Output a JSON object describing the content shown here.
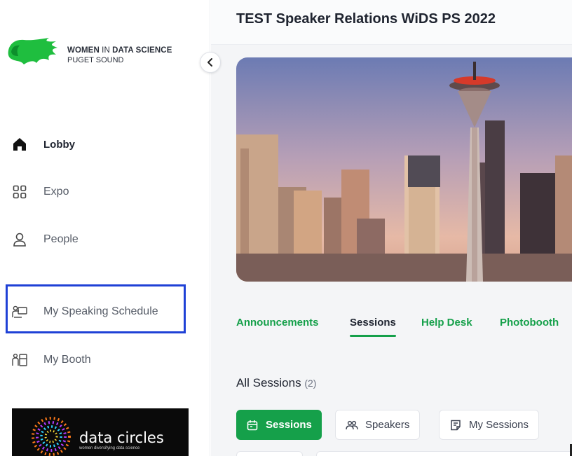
{
  "brand": {
    "name_bold1": "WOMEN",
    "name_thin": " IN ",
    "name_bold2": "DATA SCIENCE",
    "subtitle": "PUGET SOUND"
  },
  "sidebar": {
    "items": [
      {
        "label": "Lobby",
        "icon": "home-icon",
        "active": true
      },
      {
        "label": "Expo",
        "icon": "grid-icon",
        "active": false
      },
      {
        "label": "People",
        "icon": "person-icon",
        "active": false
      },
      {
        "label": "My Speaking Schedule",
        "icon": "presenter-icon",
        "active": false
      },
      {
        "label": "My Booth",
        "icon": "booth-icon",
        "active": false
      }
    ]
  },
  "sponsor": {
    "title": "data circles",
    "subtitle": "women diversifying data science"
  },
  "event": {
    "title": "TEST Speaker Relations WiDS PS 2022"
  },
  "tabs": [
    {
      "label": "Announcements",
      "active": false
    },
    {
      "label": "Sessions",
      "active": true
    },
    {
      "label": "Help Desk",
      "active": false
    },
    {
      "label": "Photobooth",
      "active": false
    }
  ],
  "sessions": {
    "heading": "All Sessions",
    "count": "(2)"
  },
  "filters": [
    {
      "label": "Sessions",
      "icon": "calendar-icon",
      "selected": true
    },
    {
      "label": "Speakers",
      "icon": "speakers-icon",
      "selected": false
    },
    {
      "label": "My Sessions",
      "icon": "bookmark-note-icon",
      "selected": false
    }
  ],
  "colors": {
    "accent_green": "#15a04a",
    "highlight_blue": "#1f41d6",
    "text_dark": "#1f2430",
    "text_muted": "#555b66"
  }
}
